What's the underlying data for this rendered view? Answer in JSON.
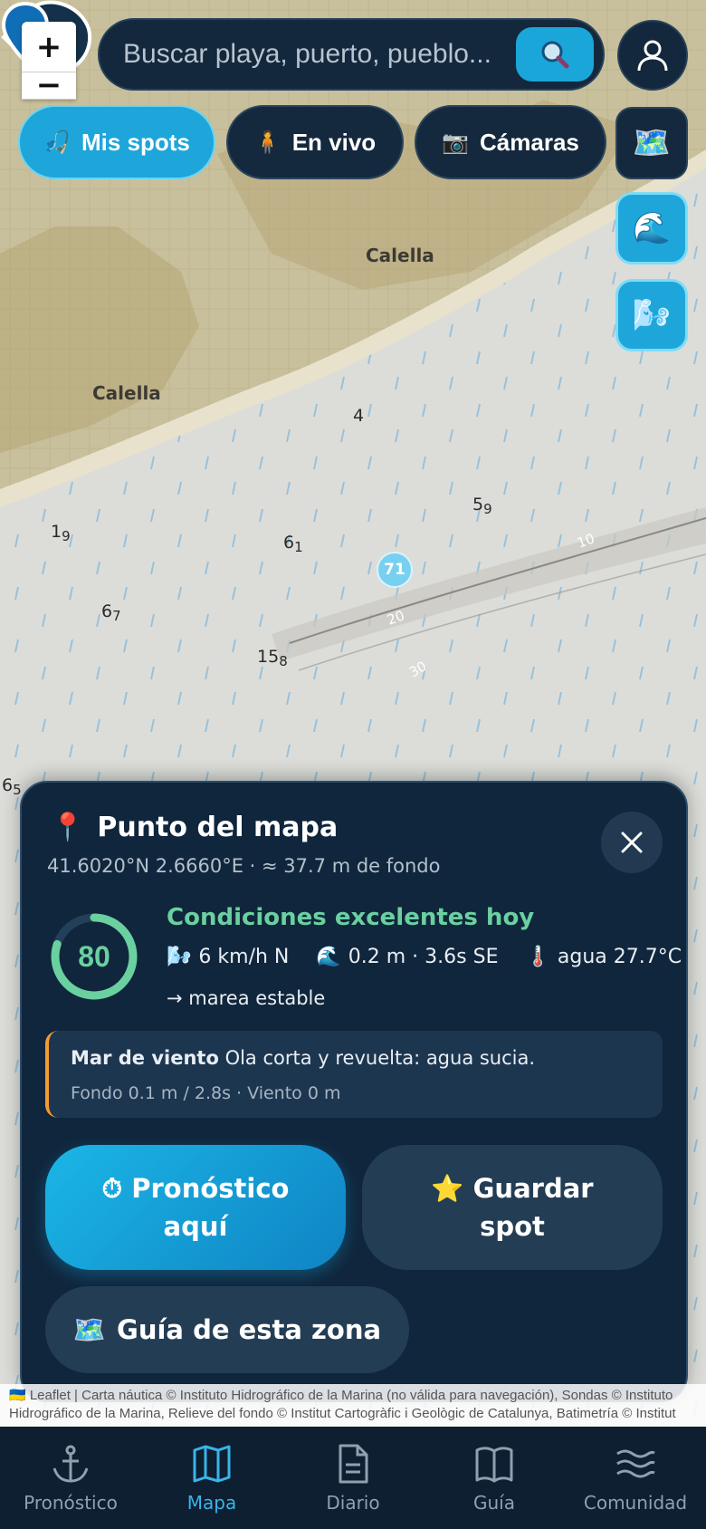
{
  "search": {
    "placeholder": "Buscar playa, puerto, pueblo..."
  },
  "zoom": {
    "in_label": "+",
    "out_label": "−"
  },
  "chips": [
    {
      "label": "Mis spots",
      "icon": "fishing-rod-icon",
      "active": true
    },
    {
      "label": "En vivo",
      "icon": "person-icon",
      "active": false
    },
    {
      "label": "Cámaras",
      "icon": "camera-icon",
      "active": false
    }
  ],
  "side_buttons": [
    {
      "icon": "map-layers-icon"
    },
    {
      "icon": "wave-icon"
    },
    {
      "icon": "wind-icon"
    }
  ],
  "map": {
    "place_labels": [
      "Calella",
      "Calella"
    ],
    "depths": [
      {
        "main": "4",
        "sub": ""
      },
      {
        "main": "5",
        "sub": "9"
      },
      {
        "main": "1",
        "sub": "9"
      },
      {
        "main": "6",
        "sub": "1"
      },
      {
        "main": "6",
        "sub": "7"
      },
      {
        "main": "15",
        "sub": "8"
      },
      {
        "main": "6",
        "sub": "5"
      }
    ],
    "spot_badge": "71"
  },
  "sheet": {
    "title": "Punto del mapa",
    "coords": "41.6020°N 2.6660°E · ≈ 37.7 m de fondo",
    "score": "80",
    "score_fraction": 0.8,
    "conditions_title": "Condiciones excelentes hoy",
    "wind": "6 km/h N",
    "wave": "0.2 m · 3.6s SE",
    "water": "agua 27.7°C",
    "tide": "→ marea estable",
    "note_title": "Mar de viento",
    "note_text": "Ola corta y revuelta: agua sucia.",
    "note_detail": "Fondo 0.1 m / 2.8s · Viento 0 m",
    "btn_forecast": "Pronóstico aquí",
    "btn_save": "Guardar spot",
    "btn_guide": "Guía de esta zona"
  },
  "attribution": "🇺🇦 Leaflet | Carta náutica © Instituto Hidrográfico de la Marina (no válida para navegación), Sondas © Instituto Hidrográfico de la Marina, Relieve del fondo © Institut Cartogràfic i Geològic de Catalunya, Batimetría © Institut",
  "nav": [
    {
      "label": "Pronóstico",
      "icon": "anchor-icon",
      "active": false
    },
    {
      "label": "Mapa",
      "icon": "map-icon",
      "active": true
    },
    {
      "label": "Diario",
      "icon": "document-icon",
      "active": false
    },
    {
      "label": "Guía",
      "icon": "book-icon",
      "active": false
    },
    {
      "label": "Comunidad",
      "icon": "waves-icon",
      "active": false
    }
  ],
  "colors": {
    "accent": "#1ea6da",
    "panel": "#10263c",
    "good": "#6ad0a0",
    "warning": "#f39a33"
  }
}
